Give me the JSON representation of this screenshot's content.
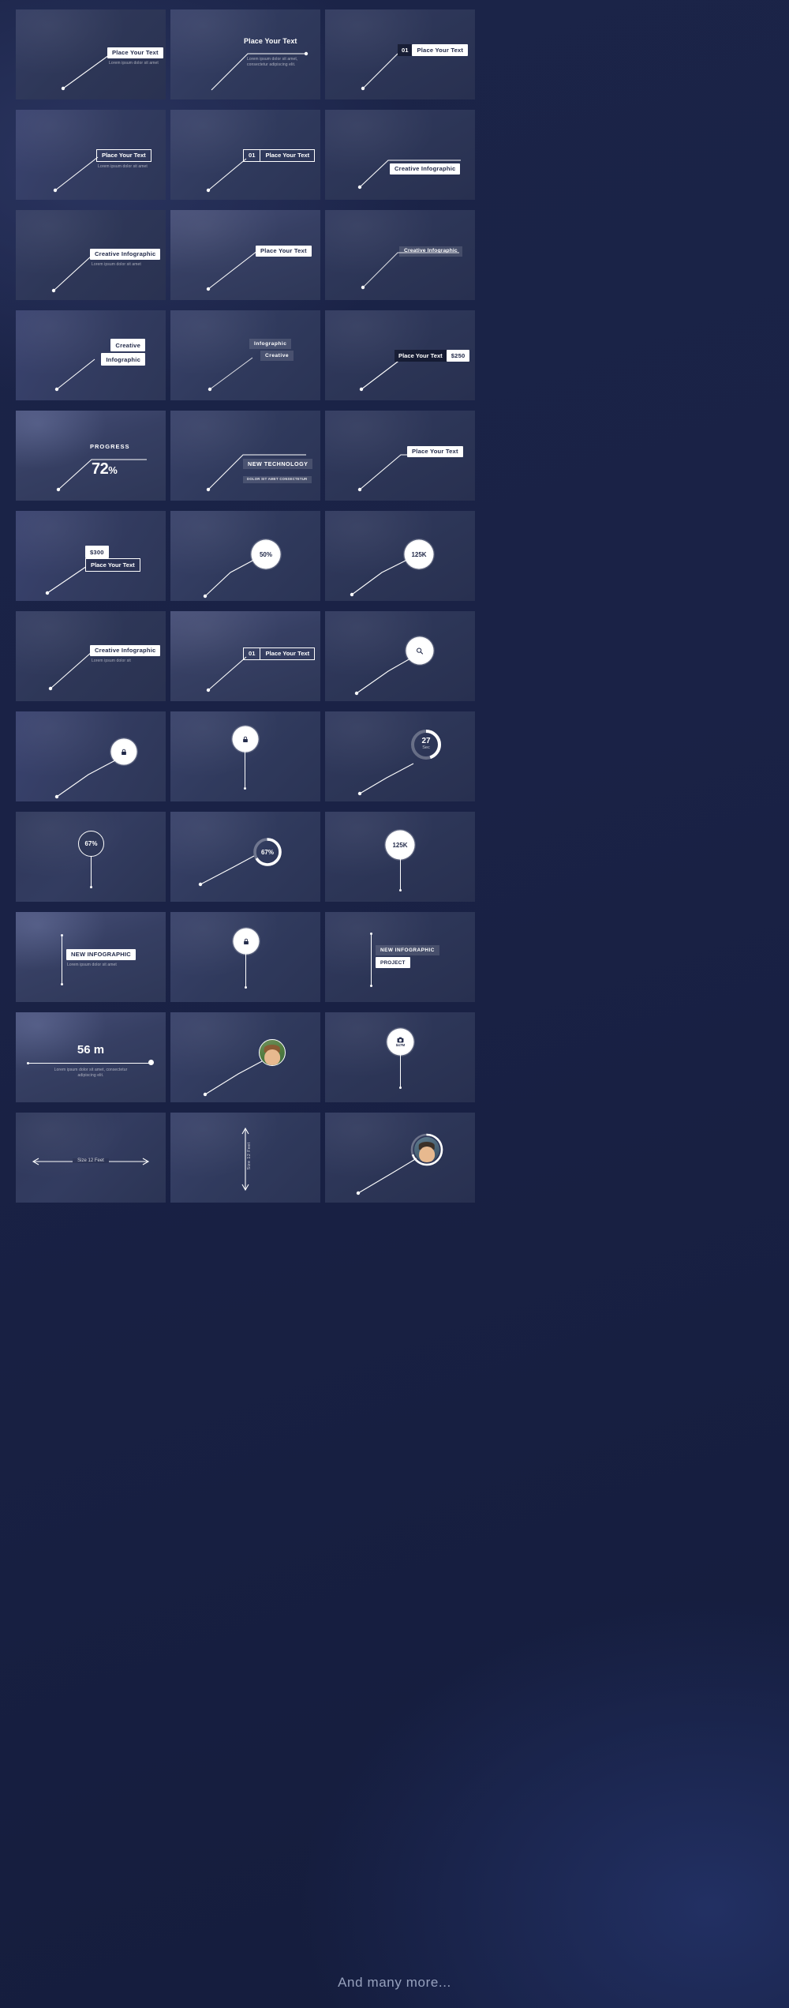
{
  "page": {
    "footer_text": "And many more...",
    "background_color": "#1c2547",
    "card_color": "#323b60",
    "accent_white": "#ffffff",
    "accent_dark": "#151b33"
  },
  "common": {
    "lorem_short": "Lorem ipsum dolor sit amet",
    "lorem_two_line_a": "Lorem ipsum dolor sit amet,",
    "lorem_two_line_b": "consectetur adipiscing elit.",
    "lorem_wrap_a": "Lorem ipsum dolor sit amet, consectetur",
    "lorem_wrap_b": "adipiscing elit."
  },
  "cards": [
    {
      "id": "r1c1",
      "style": "white-box-with-caption",
      "title": "Place Your Text",
      "subtitle": "Lorem ipsum dolor sit amet"
    },
    {
      "id": "r1c2",
      "style": "plain-text-over-rule",
      "title": "Place Your Text",
      "subtitle_line1": "Lorem ipsum dolor sit amet,",
      "subtitle_line2": "consectetur adipiscing elit."
    },
    {
      "id": "r1c3",
      "style": "number-badge-plus-white-box",
      "number": "01",
      "title": "Place Your Text"
    },
    {
      "id": "r2c1",
      "style": "outline-box-with-caption",
      "title": "Place Your Text",
      "subtitle": "Lorem ipsum dolor sit amet"
    },
    {
      "id": "r2c2",
      "style": "outline-number-plus-outline-box",
      "number": "01",
      "title": "Place Your Text"
    },
    {
      "id": "r2c3",
      "style": "white-box-under-rule",
      "title": "Creative Infographic"
    },
    {
      "id": "r3c1",
      "style": "white-box-with-caption",
      "title": "Creative Infographic",
      "subtitle": "Lorem ipsum dolor sit amet"
    },
    {
      "id": "r3c2",
      "style": "white-box-plain",
      "title": "Place Your Text"
    },
    {
      "id": "r3c3",
      "style": "ghost-box",
      "title": "Creative Infographic"
    },
    {
      "id": "r4c1",
      "style": "stacked-white-boxes",
      "line1": "Creative",
      "line2": "Infographic"
    },
    {
      "id": "r4c2",
      "style": "stacked-ghost-boxes",
      "line1": "Infographic",
      "line2": "Creative"
    },
    {
      "id": "r4c3",
      "style": "dark-box-plus-price",
      "title": "Place Your Text",
      "price": "$250"
    },
    {
      "id": "r5c1",
      "style": "progress-stat",
      "caption": "PROGRESS",
      "value": "72",
      "unit": "%"
    },
    {
      "id": "r5c2",
      "style": "ghost-headline-with-subbar",
      "title": "NEW TECHNOLOGY",
      "subtitle": "DOLOR SIT AMET CONSECTETUR"
    },
    {
      "id": "r5c3",
      "style": "white-box-under-rule",
      "title": "Place Your Text"
    },
    {
      "id": "r6c1",
      "style": "price-over-dark-box",
      "price": "$300",
      "title": "Place Your Text"
    },
    {
      "id": "r6c2",
      "style": "circle-value",
      "value": "50%"
    },
    {
      "id": "r6c3",
      "style": "circle-value",
      "value": "125K"
    },
    {
      "id": "r7c1",
      "style": "white-box-with-caption",
      "title": "Creative Infographic",
      "subtitle": "Lorem ipsum dolor sit"
    },
    {
      "id": "r7c2",
      "style": "outline-number-plus-outline-box",
      "number": "01",
      "title": "Place Your Text"
    },
    {
      "id": "r7c3",
      "style": "circle-icon",
      "icon": "search-icon"
    },
    {
      "id": "r8c1",
      "style": "circle-icon",
      "icon": "lock-icon"
    },
    {
      "id": "r8c2",
      "style": "circle-icon-pin",
      "icon": "lock-icon"
    },
    {
      "id": "r8c3",
      "style": "ring-countdown",
      "value": "27",
      "unit": "Sec",
      "progress_percent": 45
    },
    {
      "id": "r9c1",
      "style": "circle-value-pin",
      "value": "67%"
    },
    {
      "id": "r9c2",
      "style": "ring-value",
      "value": "67%",
      "progress_percent": 67
    },
    {
      "id": "r9c3",
      "style": "circle-value-pin",
      "value": "125K"
    },
    {
      "id": "r10c1",
      "style": "vertical-pin-white-box",
      "title": "NEW INFOGRAPHIC",
      "subtitle": "Lorem ipsum dolor sit amet"
    },
    {
      "id": "r10c2",
      "style": "circle-icon-pin",
      "icon": "lock-icon"
    },
    {
      "id": "r10c3",
      "style": "vertical-pin-two-boxes",
      "line1": "NEW INFOGRAPHIC",
      "line2": "PROJECT"
    },
    {
      "id": "r11c1",
      "style": "measurement-bar",
      "value": "56 m",
      "subtitle_line1": "Lorem ipsum dolor sit amet, consectetur",
      "subtitle_line2": "adipiscing elit."
    },
    {
      "id": "r11c2",
      "style": "avatar-callout",
      "avatar": "person-avatar"
    },
    {
      "id": "r11c3",
      "style": "circle-icon-pin-label",
      "icon": "camera-icon",
      "label": "$47M"
    },
    {
      "id": "r12c1",
      "style": "horizontal-dimension",
      "label": "Size 12 Feet"
    },
    {
      "id": "r12c2",
      "style": "vertical-dimension",
      "label": "Size 12 Feet"
    },
    {
      "id": "r12c3",
      "style": "avatar-callout-ring",
      "avatar": "person-avatar-2"
    }
  ]
}
